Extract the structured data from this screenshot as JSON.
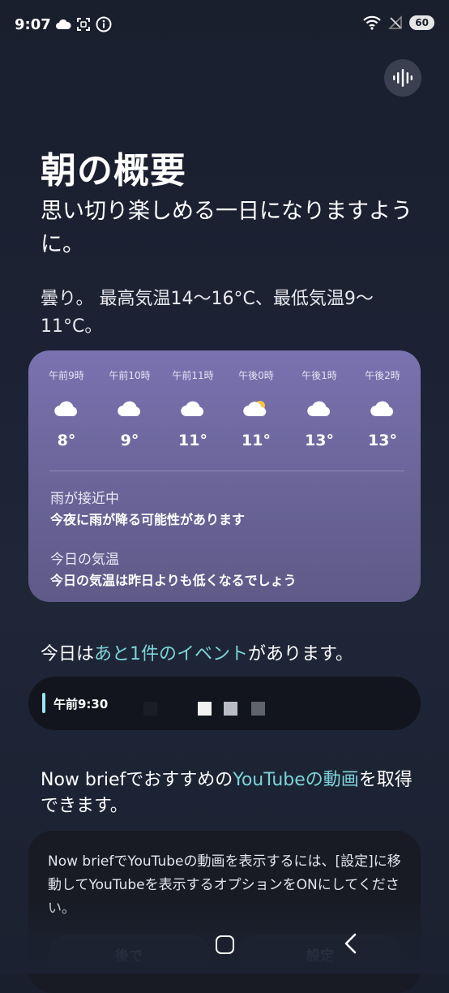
{
  "status": {
    "time": "9:07",
    "battery": "60"
  },
  "page": {
    "title": "朝の概要",
    "subtitle": "思い切り楽しめる一日になりますように。"
  },
  "weather": {
    "summary": "曇り。 最高気温14～16°C、最低気温9～11°C。",
    "hours": [
      {
        "label": "午前9時",
        "icon": "cloud-icon",
        "temp": "8°"
      },
      {
        "label": "午前10時",
        "icon": "cloud-icon",
        "temp": "9°"
      },
      {
        "label": "午前11時",
        "icon": "cloud-icon",
        "temp": "11°"
      },
      {
        "label": "午後0時",
        "icon": "partly-sunny-icon",
        "temp": "11°"
      },
      {
        "label": "午後1時",
        "icon": "cloud-icon",
        "temp": "13°"
      },
      {
        "label": "午後2時",
        "icon": "cloud-icon",
        "temp": "13°"
      }
    ],
    "alerts": [
      {
        "title": "雨が接近中",
        "text": "今夜に雨が降る可能性があります"
      },
      {
        "title": "今日の気温",
        "text": "今日の気温は昨日よりも低くなるでしょう"
      }
    ]
  },
  "events": {
    "prefix": "今日は",
    "accent": "あと1件のイベント",
    "suffix": "があります。",
    "time": "午前9:30"
  },
  "youtube": {
    "prefix": "Now briefでおすすめの",
    "accent": "YouTubeの動画",
    "suffix": "を取得できます。",
    "card_text": "Now briefでYouTubeの動画を表示するには、[設定]に移動してYouTubeを表示するオプションをONにしてください。",
    "later_button": "後で",
    "settings_button": "設定"
  },
  "colors": {
    "accent": "#7ed3d9",
    "card": "#7a72b0"
  }
}
